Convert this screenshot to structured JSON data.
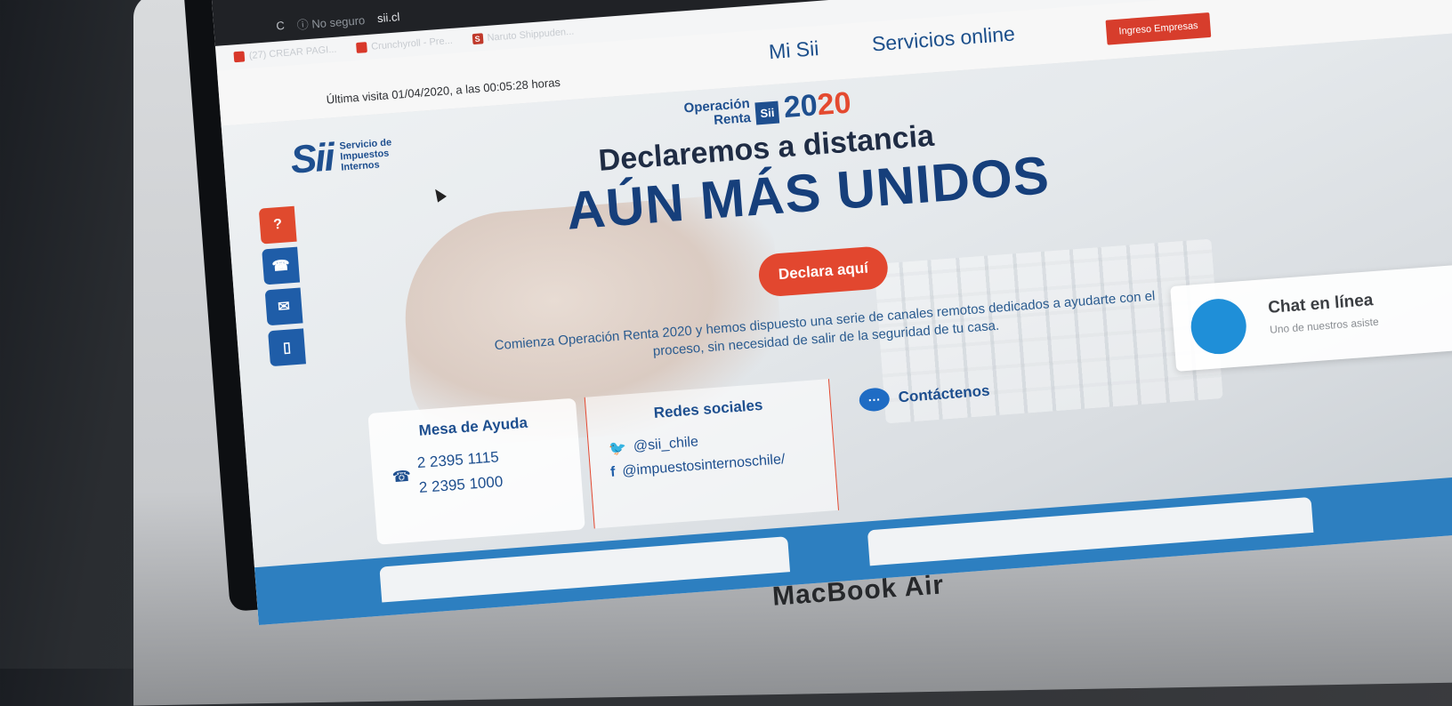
{
  "browser": {
    "reload_glyph": "C",
    "secure_label": "ⓘ No seguro",
    "url": "sii.cl",
    "bookmarks": [
      {
        "label": "(27) CREAR PAGI..."
      },
      {
        "label": "Crunchyroll - Pre..."
      },
      {
        "label": "Naruto Shippuden..."
      }
    ]
  },
  "topbar": {
    "last_visit": "Última visita 01/04/2020, a las 00:05:28 horas",
    "nav": [
      "Mi Sii",
      "Servicios online"
    ],
    "empresas_button": "Ingreso Empresas"
  },
  "logo": {
    "mark": "Sii",
    "text": "Servicio de Impuestos Internos"
  },
  "campaign": {
    "line1": "Operación",
    "line2": "Renta",
    "badge": "Sii",
    "year_prefix": "20",
    "year_suffix": "20"
  },
  "hero": {
    "headline_small": "Declaremos a distancia",
    "headline_big": "AÚN MÁS UNIDOS",
    "cta": "Declara aquí",
    "intro": "Comienza Operación Renta 2020 y hemos dispuesto una serie de canales remotos dedicados a ayudarte con el proceso, sin necesidad de salir de la seguridad de tu casa."
  },
  "side_tabs": [
    {
      "icon": "help-icon",
      "glyph": "?"
    },
    {
      "icon": "phone-icon",
      "glyph": "☎"
    },
    {
      "icon": "mail-icon",
      "glyph": "✉"
    },
    {
      "icon": "mobile-icon",
      "glyph": "▯"
    }
  ],
  "mesa": {
    "title": "Mesa de Ayuda",
    "phones": [
      "2 2395 1115",
      "2 2395 1000"
    ]
  },
  "redes": {
    "title": "Redes sociales",
    "twitter": "@sii_chile",
    "facebook": "@impuestosinternoschile/"
  },
  "contact": {
    "label": "Contáctenos"
  },
  "chat": {
    "title": "Chat en línea",
    "subtitle": "Uno de nuestros asiste"
  },
  "device_label": "MacBook Air",
  "colors": {
    "brand_blue": "#1e4f8f",
    "accent_red": "#e2472f",
    "bottom_blue": "#2d7fc0"
  }
}
